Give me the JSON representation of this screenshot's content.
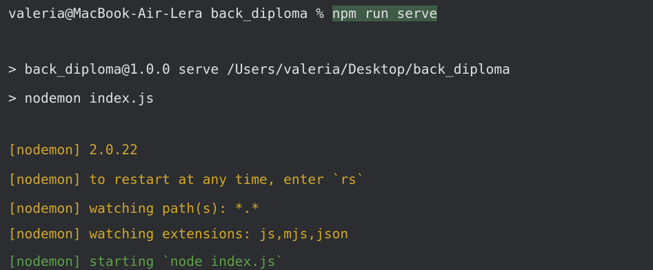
{
  "terminal": {
    "prompt": {
      "text": "valeria@MacBook-Air-Lera back_diploma % ",
      "command": "npm run serve"
    },
    "npm_lines": [
      "> back_diploma@1.0.0 serve /Users/valeria/Desktop/back_diploma",
      "> nodemon index.js"
    ],
    "nodemon_lines": [
      "[nodemon] 2.0.22",
      "[nodemon] to restart at any time, enter `rs`",
      "[nodemon] watching path(s): *.*",
      "[nodemon] watching extensions: js,mjs,json"
    ],
    "start_line": "[nodemon] starting `node index.js`"
  },
  "colors": {
    "background": "#2b2d30",
    "text": "#dfe1e5",
    "command_highlight": "#3f5b45",
    "nodemon_yellow": "#d3a82a",
    "nodemon_green": "#5fa149"
  }
}
